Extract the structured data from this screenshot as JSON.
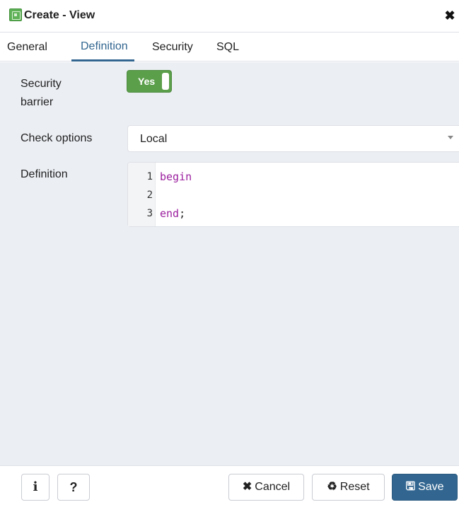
{
  "dialog": {
    "title": "Create - View",
    "close_glyph": "✖",
    "title_icon": "view-icon"
  },
  "tabs": [
    {
      "label": "General",
      "active": false
    },
    {
      "label": "Definition",
      "active": true
    },
    {
      "label": "Security",
      "active": false
    },
    {
      "label": "SQL",
      "active": false
    }
  ],
  "form": {
    "security_barrier": {
      "label_line1": "Security",
      "label_line2": "barrier",
      "toggle_label": "Yes",
      "value": true
    },
    "check_options": {
      "label": "Check options",
      "value": "Local"
    },
    "definition": {
      "label": "Definition",
      "lines": [
        {
          "number": "1",
          "keyword": "begin",
          "rest": ""
        },
        {
          "number": "2",
          "keyword": "",
          "rest": ""
        },
        {
          "number": "3",
          "keyword": "end",
          "rest": ";"
        }
      ]
    }
  },
  "footer": {
    "info_label": "i",
    "help_label": "?",
    "cancel_icon": "✖",
    "cancel_label": "Cancel",
    "reset_icon": "♻",
    "reset_label": "Reset",
    "save_icon": "🖫",
    "save_label": "Save"
  },
  "colors": {
    "accent": "#326690",
    "toggle_on": "#5b9f4a",
    "panel_bg": "#ebeef3",
    "keyword": "#9b1f9e"
  }
}
